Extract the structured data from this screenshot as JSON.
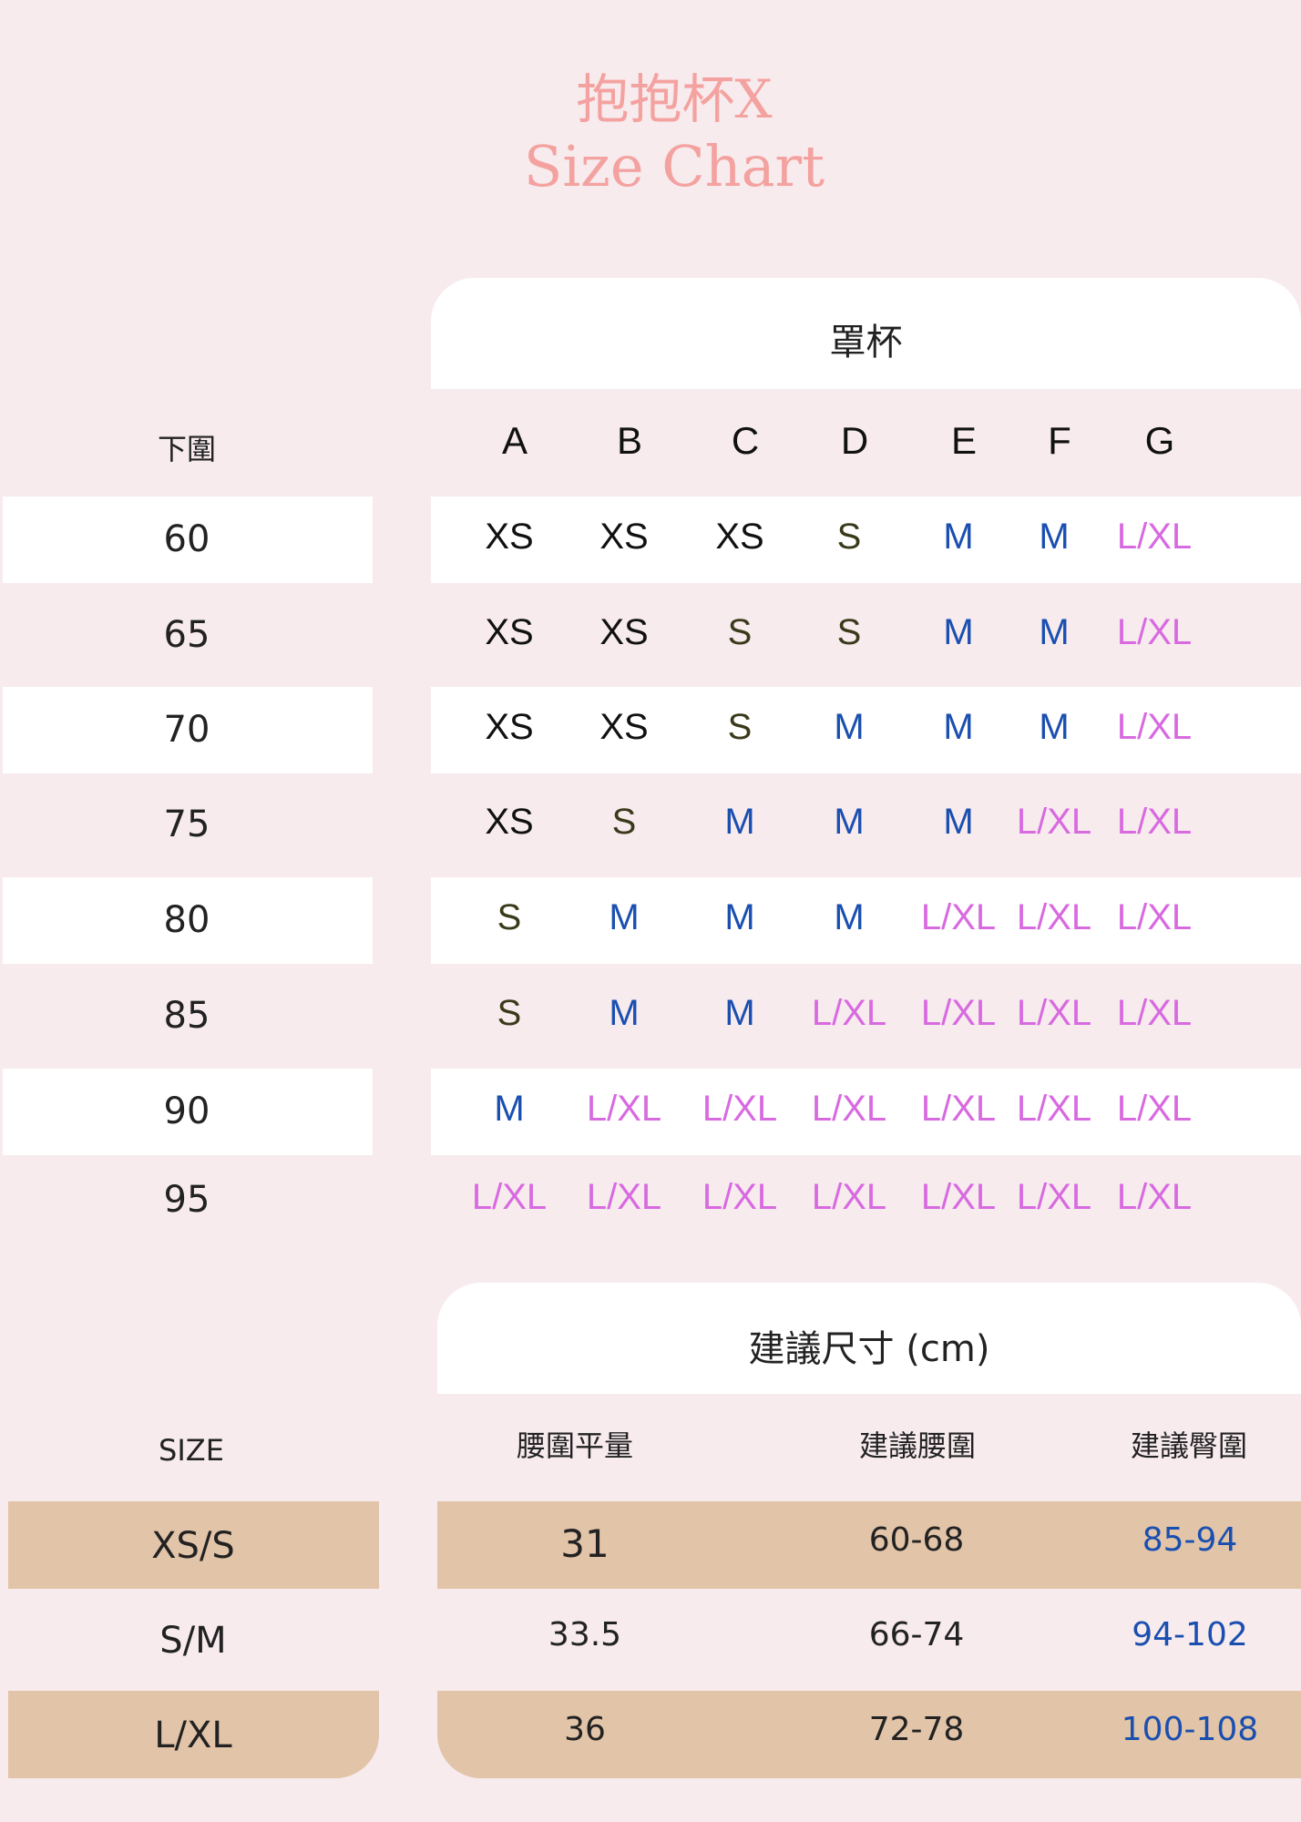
{
  "title": {
    "line1": "抱抱杯X",
    "line2": "Size Chart"
  },
  "colors": {
    "background": "#f7ebee",
    "accent": "#f4a2a0",
    "tan": "#e2c4a8",
    "xs": "#111111",
    "s": "#3a3a1a",
    "m": "#1a4fb0",
    "lxl": "#d86ae0",
    "hip": "#1a4fb0"
  },
  "cup_table": {
    "header": "罩杯",
    "row_header": "下圍",
    "columns": [
      "A",
      "B",
      "C",
      "D",
      "E",
      "F",
      "G"
    ],
    "rows": [
      {
        "band": "60",
        "sizes": [
          "XS",
          "XS",
          "XS",
          "S",
          "M",
          "M",
          "L/XL"
        ]
      },
      {
        "band": "65",
        "sizes": [
          "XS",
          "XS",
          "S",
          "S",
          "M",
          "M",
          "L/XL"
        ]
      },
      {
        "band": "70",
        "sizes": [
          "XS",
          "XS",
          "S",
          "M",
          "M",
          "M",
          "L/XL"
        ]
      },
      {
        "band": "75",
        "sizes": [
          "XS",
          "S",
          "M",
          "M",
          "M",
          "L/XL",
          "L/XL"
        ]
      },
      {
        "band": "80",
        "sizes": [
          "S",
          "M",
          "M",
          "M",
          "L/XL",
          "L/XL",
          "L/XL"
        ]
      },
      {
        "band": "85",
        "sizes": [
          "S",
          "M",
          "M",
          "L/XL",
          "L/XL",
          "L/XL",
          "L/XL"
        ]
      },
      {
        "band": "90",
        "sizes": [
          "M",
          "L/XL",
          "L/XL",
          "L/XL",
          "L/XL",
          "L/XL",
          "L/XL"
        ]
      },
      {
        "band": "95",
        "sizes": [
          "L/XL",
          "L/XL",
          "L/XL",
          "L/XL",
          "L/XL",
          "L/XL",
          "L/XL"
        ]
      }
    ]
  },
  "size_table": {
    "header": "建議尺寸 (cm)",
    "row_header": "SIZE",
    "columns": [
      "腰圍平量",
      "建議腰圍",
      "建議臀圍"
    ],
    "rows": [
      {
        "size": "XS/S",
        "values": [
          "31",
          "60-68",
          "85-94"
        ]
      },
      {
        "size": "S/M",
        "values": [
          "33.5",
          "66-74",
          "94-102"
        ]
      },
      {
        "size": "L/XL",
        "values": [
          "36",
          "72-78",
          "100-108"
        ]
      }
    ]
  }
}
